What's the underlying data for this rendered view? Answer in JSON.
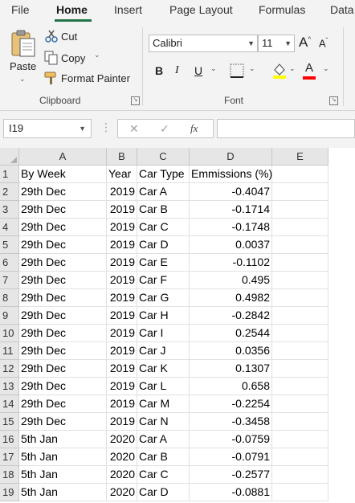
{
  "ribbon_tabs": [
    "File",
    "Home",
    "Insert",
    "Page Layout",
    "Formulas",
    "Data"
  ],
  "clipboard": {
    "paste": "Paste",
    "cut": "Cut",
    "copy": "Copy",
    "format_painter": "Format Painter",
    "group_label": "Clipboard"
  },
  "font": {
    "family": "Calibri",
    "size": "11",
    "bold": "B",
    "italic": "I",
    "underline": "U",
    "grow": "A",
    "shrink": "A",
    "font_color_letter": "A",
    "group_label": "Font"
  },
  "colors": {
    "accent": "#217346",
    "highlight": "#ffff00",
    "font_color": "#ff0000",
    "grid_line": "#e1e1e1",
    "header_bg": "#e6e6e6"
  },
  "formula_bar": {
    "name_box": "I19",
    "cancel_icon": "✕",
    "enter_icon": "✓",
    "fx": "fx",
    "formula": ""
  },
  "sheet": {
    "columns": [
      "A",
      "B",
      "C",
      "D",
      "E"
    ],
    "rows": [
      {
        "n": "1",
        "a": "By Week",
        "b": "Year",
        "c": "Car Type",
        "d": "Emmissions (%)"
      },
      {
        "n": "2",
        "a": "29th Dec",
        "b": "2019",
        "c": "Car A",
        "d": "-0.4047"
      },
      {
        "n": "3",
        "a": "29th Dec",
        "b": "2019",
        "c": "Car B",
        "d": "-0.1714"
      },
      {
        "n": "4",
        "a": "29th Dec",
        "b": "2019",
        "c": "Car C",
        "d": "-0.1748"
      },
      {
        "n": "5",
        "a": "29th Dec",
        "b": "2019",
        "c": "Car D",
        "d": "0.0037"
      },
      {
        "n": "6",
        "a": "29th Dec",
        "b": "2019",
        "c": "Car E",
        "d": "-0.1102"
      },
      {
        "n": "7",
        "a": "29th Dec",
        "b": "2019",
        "c": "Car F",
        "d": "0.495"
      },
      {
        "n": "8",
        "a": "29th Dec",
        "b": "2019",
        "c": "Car G",
        "d": "0.4982"
      },
      {
        "n": "9",
        "a": "29th Dec",
        "b": "2019",
        "c": "Car H",
        "d": "-0.2842"
      },
      {
        "n": "10",
        "a": "29th Dec",
        "b": "2019",
        "c": "Car I",
        "d": "0.2544"
      },
      {
        "n": "11",
        "a": "29th Dec",
        "b": "2019",
        "c": "Car J",
        "d": "0.0356"
      },
      {
        "n": "12",
        "a": "29th Dec",
        "b": "2019",
        "c": "Car K",
        "d": "0.1307"
      },
      {
        "n": "13",
        "a": "29th Dec",
        "b": "2019",
        "c": "Car L",
        "d": "0.658"
      },
      {
        "n": "14",
        "a": "29th Dec",
        "b": "2019",
        "c": "Car M",
        "d": "-0.2254"
      },
      {
        "n": "15",
        "a": "29th Dec",
        "b": "2019",
        "c": "Car N",
        "d": "-0.3458"
      },
      {
        "n": "16",
        "a": "5th Jan",
        "b": "2020",
        "c": "Car A",
        "d": "-0.0759"
      },
      {
        "n": "17",
        "a": "5th Jan",
        "b": "2020",
        "c": "Car B",
        "d": "-0.0791"
      },
      {
        "n": "18",
        "a": "5th Jan",
        "b": "2020",
        "c": "Car C",
        "d": "-0.2577"
      },
      {
        "n": "19",
        "a": "5th Jan",
        "b": "2020",
        "c": "Car D",
        "d": "-0.0881"
      }
    ]
  }
}
